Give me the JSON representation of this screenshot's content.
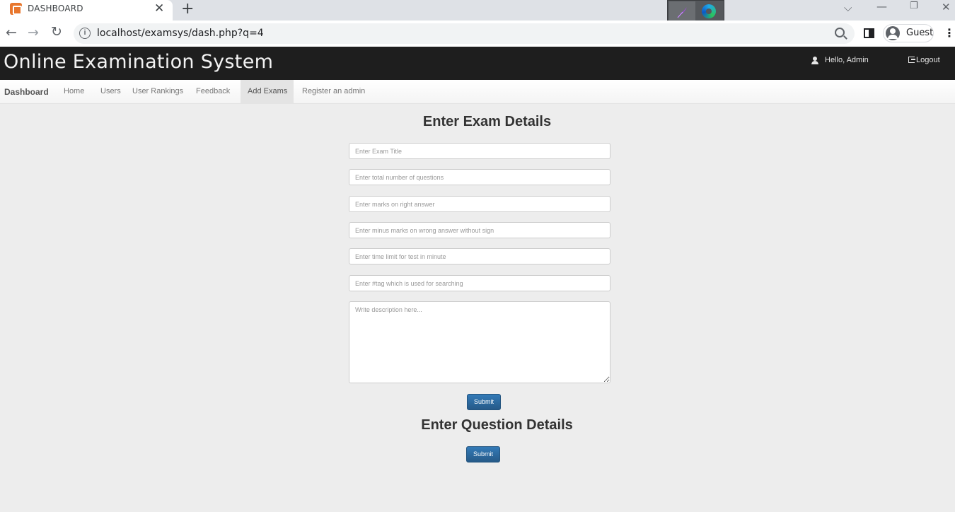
{
  "browser": {
    "tab_title": "DASHBOARD",
    "tab_close": "✕",
    "new_tab": "+",
    "url": "localhost/examsys/dash.php?q=4",
    "profile_label": "Guest",
    "back": "←",
    "forward": "→",
    "reload": "↻",
    "menu": "⋮",
    "window_controls": {
      "list": "⌵",
      "minimize": "—",
      "restore": "❐",
      "close": "✕"
    }
  },
  "header": {
    "title": "Online Examination System",
    "greeting": "Hello,  Admin",
    "logout_label": "Logout"
  },
  "nav": {
    "brand": "Dashboard",
    "items": [
      {
        "label": "Home"
      },
      {
        "label": "Users"
      },
      {
        "label": "User Rankings"
      },
      {
        "label": "Feedback"
      },
      {
        "label": "Add Exams",
        "active": true
      },
      {
        "label": "Register an admin"
      }
    ]
  },
  "exam_form": {
    "heading": "Enter Exam Details",
    "fields": [
      {
        "placeholder": "Enter Exam Title",
        "value": ""
      },
      {
        "placeholder": "Enter total number of questions",
        "value": ""
      },
      {
        "placeholder": "Enter marks on right answer",
        "value": ""
      },
      {
        "placeholder": "Enter minus marks on wrong answer without sign",
        "value": ""
      },
      {
        "placeholder": "Enter time limit for test in minute",
        "value": ""
      },
      {
        "placeholder": "Enter #tag which is used for searching",
        "value": ""
      }
    ],
    "description_placeholder": "Write description here...",
    "submit_label": "Submit"
  },
  "question_form": {
    "heading": "Enter Question Details",
    "submit_label": "Submit"
  },
  "colors": {
    "header_bg": "#1e1e1e",
    "page_bg": "#ededed",
    "button_primary": "#2d6ca2",
    "favicon": "#e8772e"
  }
}
